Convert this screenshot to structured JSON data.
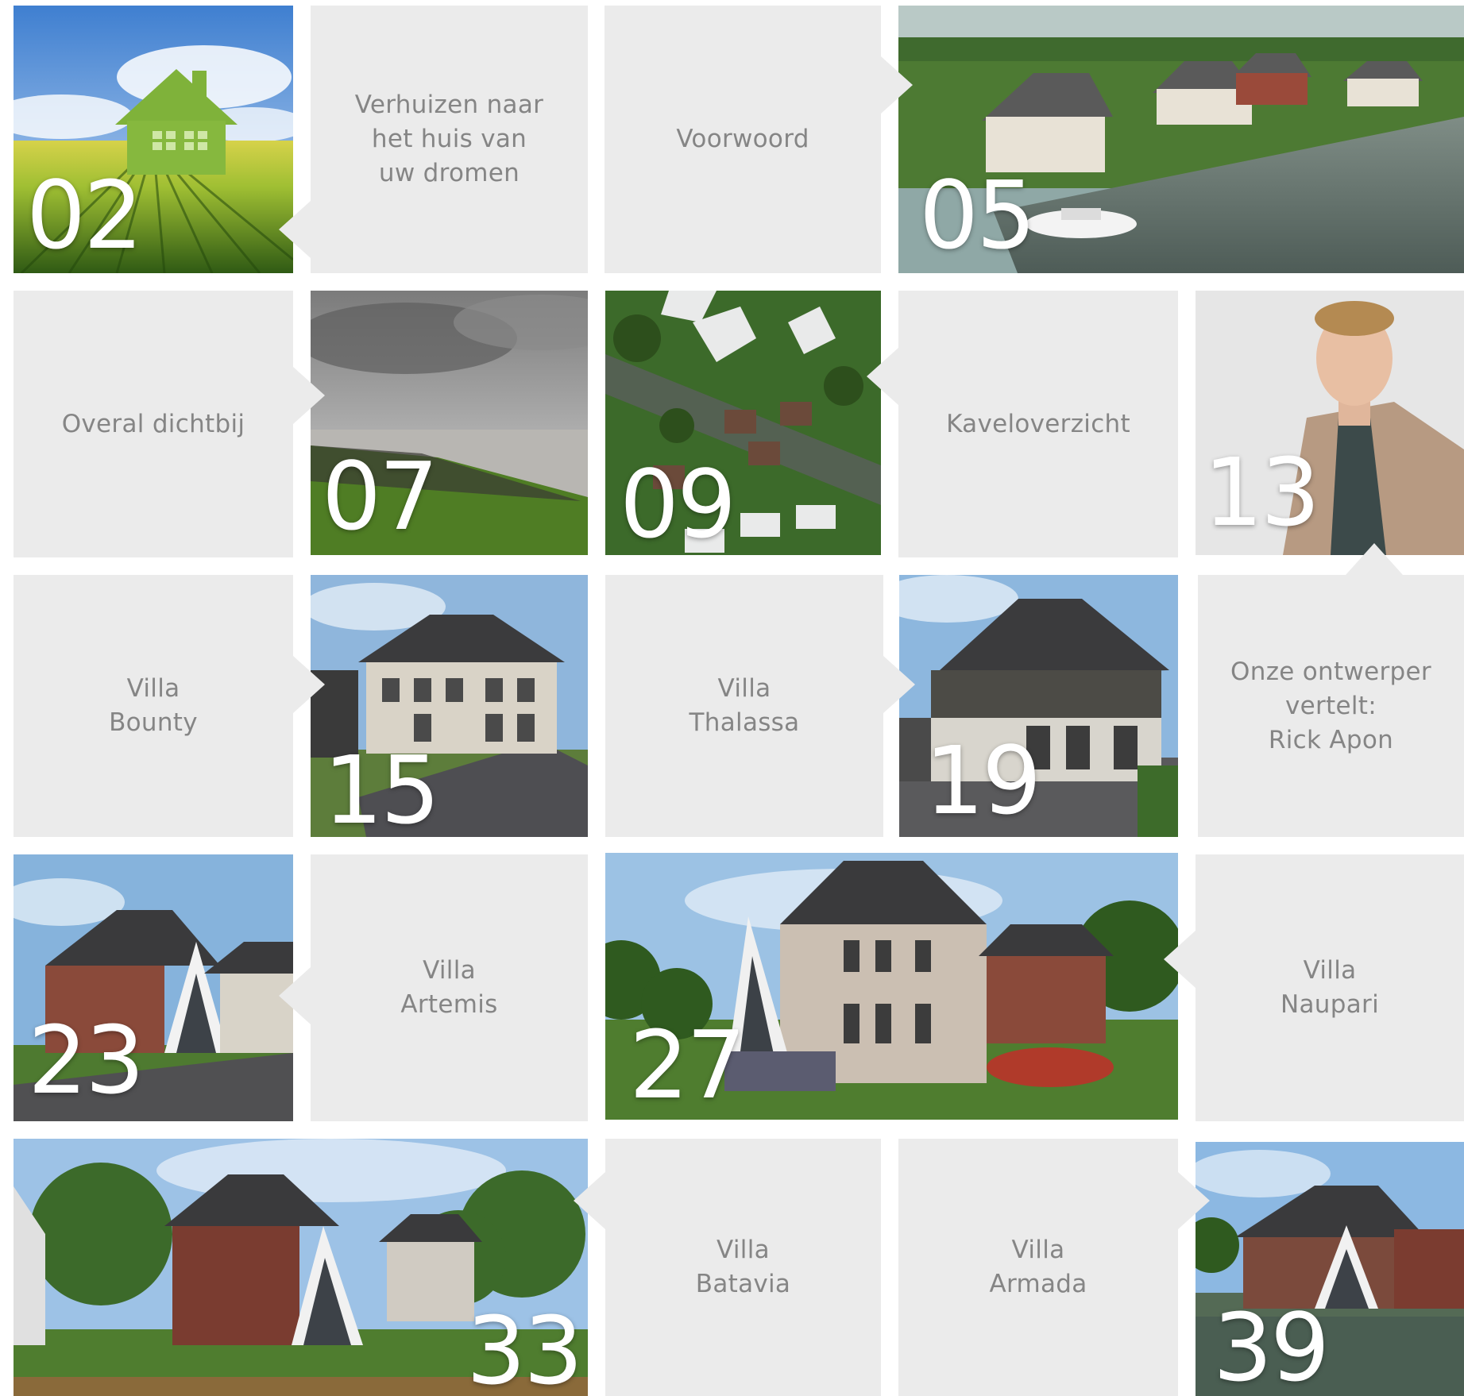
{
  "colors": {
    "tile_background": "#ebebeb",
    "label_text": "#858585",
    "page_number": "#ffffff"
  },
  "tiles": {
    "p02": {
      "number": "02",
      "image": "green house field"
    },
    "t_verhuizen": {
      "label": "Verhuizen naar\nhet huis van\nuw dromen"
    },
    "t_voorwoord": {
      "label": "Voorwoord"
    },
    "p05": {
      "number": "05",
      "image": "aerial villas by water"
    },
    "t_overal": {
      "label": "Overal dichtbij"
    },
    "p07": {
      "number": "07",
      "image": "lake shore"
    },
    "p09": {
      "number": "09",
      "image": "aerial plots"
    },
    "t_kavel": {
      "label": "Kaveloverzicht"
    },
    "p13": {
      "number": "13",
      "image": "portrait designer"
    },
    "t_bounty": {
      "label": "Villa\nBounty"
    },
    "p15": {
      "number": "15",
      "image": "villa bounty"
    },
    "t_thalassa": {
      "label": "Villa\nThalassa"
    },
    "p19": {
      "number": "19",
      "image": "villa thalassa"
    },
    "t_ontwerper": {
      "label": "Onze ontwerper\nvertelt:\nRick Apon"
    },
    "p23": {
      "number": "23",
      "image": "villa artemis"
    },
    "t_artemis": {
      "label": "Villa\nArtemis"
    },
    "p27": {
      "number": "27",
      "image": "villa naupari"
    },
    "t_naupari": {
      "label": "Villa\nNaupari"
    },
    "p33": {
      "number": "33",
      "image": "villa batavia"
    },
    "t_batavia": {
      "label": "Villa\nBatavia"
    },
    "t_armada": {
      "label": "Villa\nArmada"
    },
    "p39": {
      "number": "39",
      "image": "villa armada"
    }
  }
}
